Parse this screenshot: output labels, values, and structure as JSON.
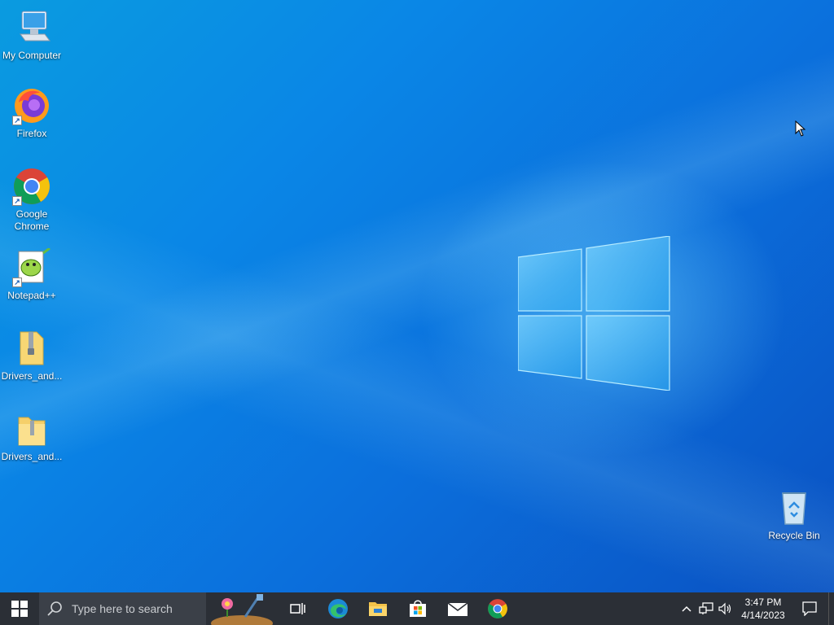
{
  "desktop": {
    "icons": [
      {
        "label": "My Computer"
      },
      {
        "label": "Firefox"
      },
      {
        "label": "Google Chrome"
      },
      {
        "label": "Notepad++"
      },
      {
        "label": "Drivers_and..."
      },
      {
        "label": "Drivers_and..."
      },
      {
        "label": "Recycle Bin"
      }
    ]
  },
  "taskbar": {
    "search_placeholder": "Type here to search",
    "pinned": [
      "task-view-icon",
      "edge-icon",
      "file-explorer-icon",
      "microsoft-store-icon",
      "mail-icon",
      "chrome-icon"
    ],
    "clock": {
      "time": "3:47 PM",
      "date": "4/14/2023"
    }
  },
  "colors": {
    "taskbar": "#2b2f36",
    "search_bg": "#3b4048",
    "wallpaper_accent": "#0a86e6"
  }
}
